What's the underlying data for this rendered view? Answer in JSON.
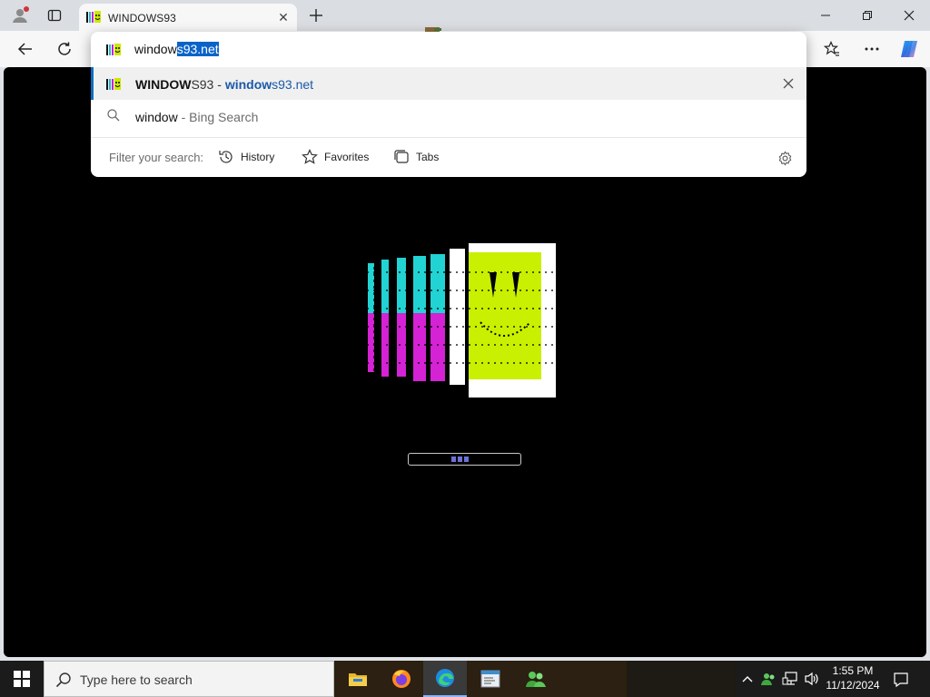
{
  "tab": {
    "title": "WINDOWS93",
    "close_glyph": "✕",
    "favicon": "windows93-icon"
  },
  "window_controls": {
    "minimize": "minimize-icon",
    "maximize": "restore-icon",
    "close": "close-icon"
  },
  "omnibox": {
    "typed_text": "window",
    "autocomplete_text": "s93.net",
    "suggestions": [
      {
        "title_bold": "WINDOW",
        "title_rest": "S93",
        "separator": " - ",
        "url_bold": "window",
        "url_rest": "s93.net"
      },
      {
        "query": "window",
        "suffix": " - Bing Search"
      }
    ],
    "filter_label": "Filter your search:",
    "filters": [
      "History",
      "Favorites",
      "Tabs"
    ]
  },
  "page": {
    "loading_progress_fraction": 0.12,
    "background_color": "#000000"
  },
  "taskbar": {
    "search_placeholder": "Type here to search",
    "apps": [
      "file-explorer-icon",
      "firefox-icon",
      "edge-icon",
      "notepad-icon",
      "users-icon"
    ],
    "time": "1:55 PM",
    "date": "11/12/2024"
  },
  "colors": {
    "accent": "#0f6cbd",
    "selection": "#0a63c9",
    "logo_cyan": "#22d3d3",
    "logo_magenta": "#d422d4",
    "logo_lime": "#c8f000"
  }
}
